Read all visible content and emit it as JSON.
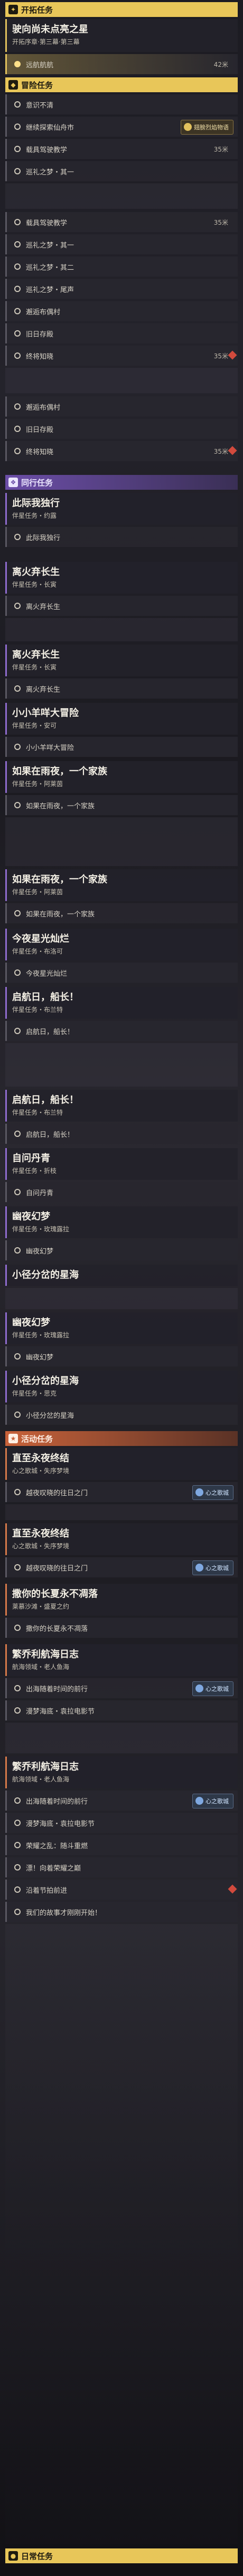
{
  "sections": {
    "trailblaze": "开拓任务",
    "adventure": "冒险任务",
    "companion": "同行任务",
    "event": "活动任务",
    "daily": "日常任务"
  },
  "trailblaze_quest": {
    "title": "驶向尚未点亮之星",
    "subtitle": "开拓序章·第三幕·第三幕",
    "step": "远航航航",
    "distance": "42米"
  },
  "adventure_block1": [
    {
      "text": "意识不清",
      "dist": ""
    },
    {
      "text": "继续探索仙舟市",
      "dist": "",
      "badge": "翅膀烈焰物语"
    },
    {
      "text": "载具驾驶教学",
      "dist": "35米"
    },
    {
      "text": "巡礼之梦・其一",
      "dist": ""
    }
  ],
  "adventure_block2": [
    {
      "text": "载具驾驶教学",
      "dist": "35米"
    },
    {
      "text": "巡礼之梦・其一",
      "dist": ""
    },
    {
      "text": "巡礼之梦・其二",
      "dist": ""
    },
    {
      "text": "巡礼之梦・尾声",
      "dist": ""
    },
    {
      "text": "邂逅布偶村",
      "dist": ""
    },
    {
      "text": "旧日存殿",
      "dist": ""
    },
    {
      "text": "终将知晓",
      "dist": "35米"
    }
  ],
  "adventure_block3": [
    {
      "text": "邂逅布偶村",
      "dist": ""
    },
    {
      "text": "旧日存殿",
      "dist": ""
    },
    {
      "text": "终将知晓",
      "dist": "35米"
    }
  ],
  "companion_quests": [
    {
      "title": "此际我独行",
      "sub": "伴星任务・约露",
      "step": "此际我独行"
    },
    {
      "title": "离火弃长生",
      "sub": "伴星任务・长寅",
      "step": "离火弃长生"
    },
    {
      "title": "离火弃长生",
      "sub": "伴星任务・长寅",
      "step": "离火弃长生"
    },
    {
      "title": "小小羊咩大冒险",
      "sub": "伴星任务・安可",
      "step": "小小羊咩大冒险"
    },
    {
      "title": "如果在雨夜，一个家族",
      "sub": "伴星任务・阿莱茵",
      "step": "如果在雨夜，一个家族"
    },
    {
      "title": "如果在雨夜，一个家族",
      "sub": "伴星任务・阿莱茵",
      "step": "如果在雨夜，一个家族"
    },
    {
      "title": "今夜星光灿烂",
      "sub": "伴星任务・布洛可",
      "step": "今夜星光灿烂"
    },
    {
      "title": "启航日，船长！",
      "sub": "伴星任务・布兰特",
      "step": "启航日，船长！"
    },
    {
      "title": "启航日，船长！",
      "sub": "伴星任务・布兰特",
      "step": ""
    },
    {
      "title": "启航日，船长！",
      "sub": "伴星任务・布兰特",
      "step": "启航日，船长！"
    },
    {
      "title": "自问丹青",
      "sub": "伴星任务・折枝",
      "step": "自问丹青"
    },
    {
      "title": "幽夜幻梦",
      "sub": "伴星任务・玫瑰露拉",
      "step": "幽夜幻梦"
    },
    {
      "title": "小径分岔的星海",
      "sub": "",
      "step": ""
    },
    {
      "title": "幽夜幻梦",
      "sub": "伴星任务・玫瑰露拉",
      "step": "幽夜幻梦"
    },
    {
      "title": "小径分岔的星海",
      "sub": "伴星任务・思克",
      "step": "小径分岔的星海"
    }
  ],
  "event_quests": [
    {
      "title": "直至永夜终结",
      "sub": "心之歌城・失序梦境",
      "step": "越夜叹晓的往日之门",
      "badge": "心之歌城"
    },
    {
      "title": "直至永夜终结",
      "sub": "心之歌城・失序梦境",
      "step": "越夜叹晓的往日之门",
      "badge": "心之歌城"
    },
    {
      "title": "撒你的长夏永不凋落",
      "sub": "莱慕沙滩・盛夏之约",
      "step": "撒你的长夏永不凋落",
      "badge": ""
    },
    {
      "title": "繁乔利航海日志",
      "sub": "航海领域・老人鱼海",
      "step": "出海随着时间的前行",
      "badge": "心之歌城"
    },
    {
      "title": "繁乔利航海日志",
      "sub": "航海领域・老人鱼海",
      "step": "",
      "badge": "心之歌城"
    }
  ],
  "event_steps": [
    {
      "text": "出海随着时间的前行",
      "dist": ""
    },
    {
      "text": "漫梦海底・袁拉电影节",
      "dist": ""
    },
    {
      "text": "荣耀之乱：随斗重燃",
      "dist": ""
    },
    {
      "text": "漂！向着荣耀之巅",
      "dist": ""
    },
    {
      "text": "沿着节拍前进",
      "dist": ""
    },
    {
      "text": "我们的故事才刚刚开始！",
      "dist": ""
    }
  ],
  "colors": {
    "gold": "#e2c15d",
    "purple": "#8f6ccf",
    "orange": "#d77a4a",
    "marker_red": "#d24a3d"
  }
}
